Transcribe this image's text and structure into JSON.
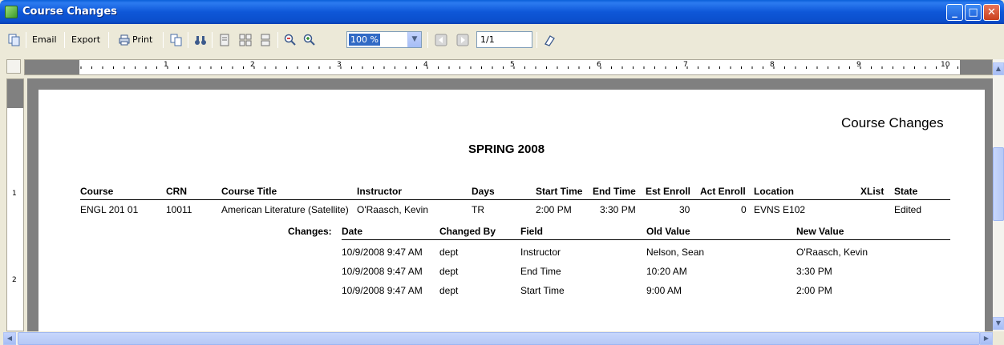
{
  "window": {
    "title": "Course Changes"
  },
  "toolbar": {
    "email_label": "Email",
    "export_label": "Export",
    "print_label": "Print",
    "zoom_value": "100 %",
    "page_value": "1/1"
  },
  "ruler": {
    "marks": [
      "1",
      "2",
      "3",
      "4",
      "5",
      "6",
      "7",
      "8",
      "9",
      "10"
    ]
  },
  "vruler": {
    "marks": [
      "1",
      "2"
    ]
  },
  "report": {
    "title": "Course Changes",
    "term": "SPRING 2008",
    "headers": {
      "course": "Course",
      "crn": "CRN",
      "title": "Course Title",
      "instructor": "Instructor",
      "days": "Days",
      "start": "Start Time",
      "end": "End Time",
      "est": "Est Enroll",
      "act": "Act Enroll",
      "location": "Location",
      "xlist": "XList",
      "state": "State"
    },
    "row": {
      "course": "ENGL 201 01",
      "crn": "10011",
      "title": "American Literature (Satellite)",
      "instructor": "O'Raasch, Kevin",
      "days": "TR",
      "start": "2:00 PM",
      "end": "3:30 PM",
      "est": "30",
      "act": "0",
      "location": "EVNS E102",
      "xlist": "",
      "state": "Edited"
    },
    "changes_label": "Changes:",
    "change_headers": {
      "date": "Date",
      "by": "Changed By",
      "field": "Field",
      "old": "Old Value",
      "new": "New Value"
    },
    "changes": [
      {
        "date": "10/9/2008 9:47 AM",
        "by": "dept",
        "field": "Instructor",
        "old": "Nelson, Sean",
        "new": "O'Raasch, Kevin"
      },
      {
        "date": "10/9/2008 9:47 AM",
        "by": "dept",
        "field": "End Time",
        "old": "10:20 AM",
        "new": "3:30 PM"
      },
      {
        "date": "10/9/2008 9:47 AM",
        "by": "dept",
        "field": "Start Time",
        "old": "9:00 AM",
        "new": "2:00 PM"
      }
    ]
  }
}
